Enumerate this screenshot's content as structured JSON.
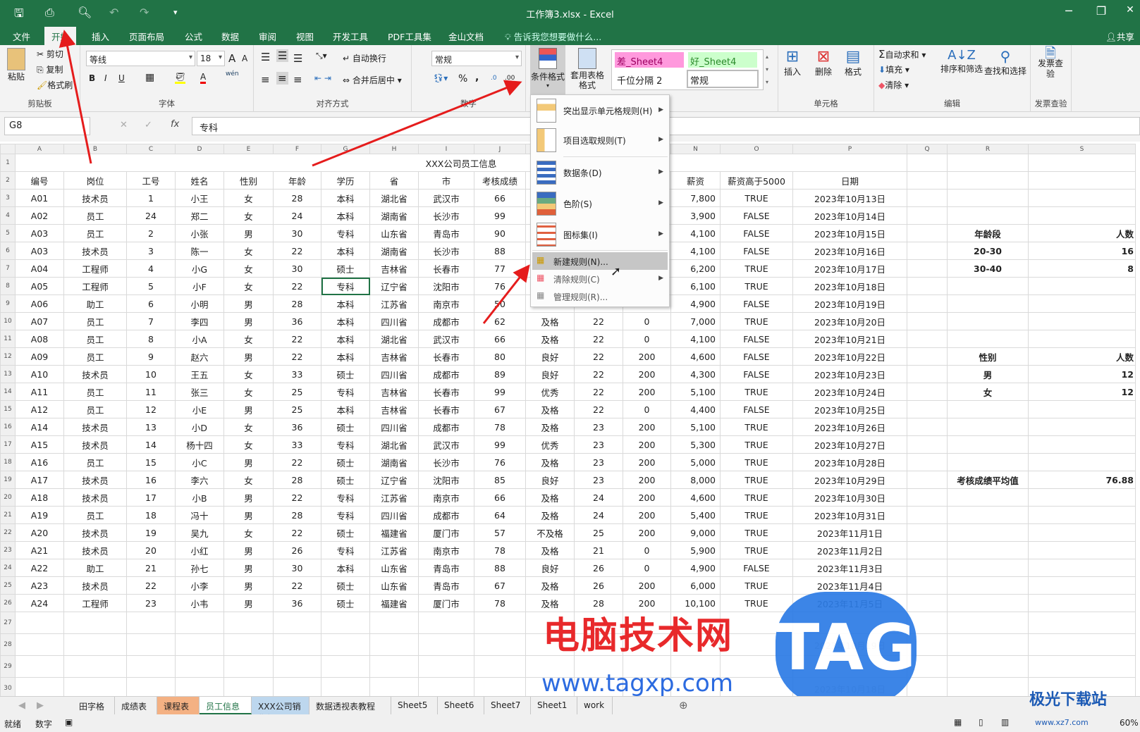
{
  "window": {
    "title": "工作簿3.xlsx - Excel",
    "minimize": "─",
    "restore": "❐",
    "close": "✕"
  },
  "ribbon_tabs": [
    "文件",
    "开始",
    "插入",
    "页面布局",
    "公式",
    "数据",
    "审阅",
    "视图",
    "开发工具",
    "PDF工具集",
    "金山文档"
  ],
  "tell_me": "告诉我您想要做什么...",
  "share": "共享",
  "clipboard": {
    "paste": "粘贴",
    "cut": "剪切",
    "copy": "复制",
    "format_painter": "格式刷",
    "label": "剪贴板"
  },
  "font": {
    "name": "等线",
    "size": "18",
    "bold": "B",
    "italic": "I",
    "underline": "U",
    "label": "字体",
    "grow": "A",
    "shrink": "A",
    "phonetic": "wén"
  },
  "alignment": {
    "wrap": "自动换行",
    "merge": "合并后居中",
    "label": "对齐方式"
  },
  "number": {
    "format": "常规",
    "percent": "%",
    "comma": ",",
    "label": "数字",
    "inc": ".00",
    "dec": ".0"
  },
  "styles": {
    "conditional": "条件格式",
    "table_format": "套用表格格式",
    "cell_styles": [
      "差_Sheet4",
      "好_Sheet4",
      "千位分隔 2",
      "常规"
    ],
    "bad_color": "#ff99dd",
    "good_color": "#ccffcc"
  },
  "cells": {
    "insert": "插入",
    "delete": "删除",
    "format": "格式",
    "label": "单元格"
  },
  "editing": {
    "autosum": "自动求和",
    "fill": "填充",
    "clear": "清除",
    "sort": "排序和筛选",
    "find": "查找和选择",
    "label": "编辑"
  },
  "invoice": {
    "button": "发票查验",
    "label": "发票查验"
  },
  "formula_bar": {
    "name_box": "G8",
    "fx": "fx",
    "value": "专科"
  },
  "columns": [
    "A",
    "B",
    "C",
    "D",
    "E",
    "F",
    "G",
    "H",
    "I",
    "J",
    "K",
    "L",
    "M",
    "N",
    "O",
    "P",
    "Q",
    "R",
    "S"
  ],
  "sheet": {
    "title": "XXX公司员工信息",
    "headers": [
      "编号",
      "岗位",
      "工号",
      "姓名",
      "性别",
      "年龄",
      "学历",
      "省",
      "市",
      "考核成绩",
      "",
      "",
      "",
      "薪资",
      "薪资高于5000",
      "日期"
    ],
    "rows": [
      [
        "A01",
        "技术员",
        "1",
        "小王",
        "女",
        "28",
        "本科",
        "湖北省",
        "武汉市",
        "66",
        "",
        "",
        "",
        "7,800",
        "TRUE",
        "2023年10月13日"
      ],
      [
        "A02",
        "员工",
        "24",
        "郑二",
        "女",
        "24",
        "本科",
        "湖南省",
        "长沙市",
        "99",
        "",
        "",
        "",
        "3,900",
        "FALSE",
        "2023年10月14日"
      ],
      [
        "A03",
        "员工",
        "2",
        "小张",
        "男",
        "30",
        "专科",
        "山东省",
        "青岛市",
        "90",
        "",
        "",
        "",
        "4,100",
        "FALSE",
        "2023年10月15日"
      ],
      [
        "A03",
        "技术员",
        "3",
        "陈一",
        "女",
        "22",
        "本科",
        "湖南省",
        "长沙市",
        "88",
        "",
        "",
        "",
        "4,100",
        "FALSE",
        "2023年10月16日"
      ],
      [
        "A04",
        "工程师",
        "4",
        "小G",
        "女",
        "30",
        "硕士",
        "吉林省",
        "长春市",
        "77",
        "",
        "",
        "",
        "6,200",
        "TRUE",
        "2023年10月17日"
      ],
      [
        "A05",
        "工程师",
        "5",
        "小F",
        "女",
        "22",
        "专科",
        "辽宁省",
        "沈阳市",
        "76",
        "",
        "",
        "",
        "6,100",
        "TRUE",
        "2023年10月18日"
      ],
      [
        "A06",
        "助工",
        "6",
        "小明",
        "男",
        "28",
        "本科",
        "江苏省",
        "南京市",
        "50",
        "",
        "",
        "",
        "4,900",
        "FALSE",
        "2023年10月19日"
      ],
      [
        "A07",
        "员工",
        "7",
        "李四",
        "男",
        "36",
        "本科",
        "四川省",
        "成都市",
        "62",
        "及格",
        "22",
        "0",
        "7,000",
        "TRUE",
        "2023年10月20日"
      ],
      [
        "A08",
        "员工",
        "8",
        "小A",
        "女",
        "22",
        "本科",
        "湖北省",
        "武汉市",
        "66",
        "及格",
        "22",
        "0",
        "4,100",
        "FALSE",
        "2023年10月21日"
      ],
      [
        "A09",
        "员工",
        "9",
        "赵六",
        "男",
        "22",
        "本科",
        "吉林省",
        "长春市",
        "80",
        "良好",
        "22",
        "200",
        "4,600",
        "FALSE",
        "2023年10月22日"
      ],
      [
        "A10",
        "技术员",
        "10",
        "王五",
        "女",
        "33",
        "硕士",
        "四川省",
        "成都市",
        "89",
        "良好",
        "22",
        "200",
        "4,300",
        "FALSE",
        "2023年10月23日"
      ],
      [
        "A11",
        "员工",
        "11",
        "张三",
        "女",
        "25",
        "专科",
        "吉林省",
        "长春市",
        "99",
        "优秀",
        "22",
        "200",
        "5,100",
        "TRUE",
        "2023年10月24日"
      ],
      [
        "A12",
        "员工",
        "12",
        "小E",
        "男",
        "25",
        "本科",
        "吉林省",
        "长春市",
        "67",
        "及格",
        "22",
        "0",
        "4,400",
        "FALSE",
        "2023年10月25日"
      ],
      [
        "A14",
        "技术员",
        "13",
        "小D",
        "女",
        "36",
        "硕士",
        "四川省",
        "成都市",
        "78",
        "及格",
        "23",
        "200",
        "5,100",
        "TRUE",
        "2023年10月26日"
      ],
      [
        "A15",
        "技术员",
        "14",
        "杨十四",
        "女",
        "33",
        "专科",
        "湖北省",
        "武汉市",
        "99",
        "优秀",
        "23",
        "200",
        "5,300",
        "TRUE",
        "2023年10月27日"
      ],
      [
        "A16",
        "员工",
        "15",
        "小C",
        "男",
        "22",
        "硕士",
        "湖南省",
        "长沙市",
        "76",
        "及格",
        "23",
        "200",
        "5,000",
        "TRUE",
        "2023年10月28日"
      ],
      [
        "A17",
        "技术员",
        "16",
        "李六",
        "女",
        "28",
        "硕士",
        "辽宁省",
        "沈阳市",
        "85",
        "良好",
        "23",
        "200",
        "8,000",
        "TRUE",
        "2023年10月29日"
      ],
      [
        "A18",
        "技术员",
        "17",
        "小B",
        "男",
        "22",
        "专科",
        "江苏省",
        "南京市",
        "66",
        "及格",
        "24",
        "200",
        "4,600",
        "TRUE",
        "2023年10月30日"
      ],
      [
        "A19",
        "员工",
        "18",
        "冯十",
        "男",
        "28",
        "专科",
        "四川省",
        "成都市",
        "64",
        "及格",
        "24",
        "200",
        "5,400",
        "TRUE",
        "2023年10月31日"
      ],
      [
        "A20",
        "技术员",
        "19",
        "吴九",
        "女",
        "22",
        "硕士",
        "福建省",
        "厦门市",
        "57",
        "不及格",
        "25",
        "200",
        "9,000",
        "TRUE",
        "2023年11月1日"
      ],
      [
        "A21",
        "技术员",
        "20",
        "小红",
        "男",
        "26",
        "专科",
        "江苏省",
        "南京市",
        "78",
        "及格",
        "21",
        "0",
        "5,900",
        "TRUE",
        "2023年11月2日"
      ],
      [
        "A22",
        "助工",
        "21",
        "孙七",
        "男",
        "30",
        "本科",
        "山东省",
        "青岛市",
        "88",
        "良好",
        "26",
        "0",
        "4,900",
        "FALSE",
        "2023年11月3日"
      ],
      [
        "A23",
        "技术员",
        "22",
        "小李",
        "男",
        "22",
        "硕士",
        "山东省",
        "青岛市",
        "67",
        "及格",
        "26",
        "200",
        "6,000",
        "TRUE",
        "2023年11月4日"
      ],
      [
        "A24",
        "工程师",
        "23",
        "小韦",
        "男",
        "36",
        "硕士",
        "福建省",
        "厦门市",
        "78",
        "及格",
        "28",
        "200",
        "10,100",
        "TRUE",
        "2023年11月5日"
      ]
    ],
    "side": {
      "5": [
        "年龄段",
        "人数"
      ],
      "6": [
        "20-30",
        "16"
      ],
      "7": [
        "30-40",
        "8"
      ],
      "12": [
        "性别",
        "人数"
      ],
      "13": [
        "男",
        "12"
      ],
      "14": [
        "女",
        "12"
      ],
      "19": [
        "考核成绩平均值",
        "76.88"
      ]
    },
    "extra_rows": {
      "28": "2023年10月19日",
      "30": "2023年10月18日"
    }
  },
  "menu": {
    "items": [
      {
        "label": "突出显示单元格规则(H)",
        "sub": true
      },
      {
        "label": "项目选取规则(T)",
        "sub": true
      },
      {
        "label": "数据条(D)",
        "sub": true
      },
      {
        "label": "色阶(S)",
        "sub": true
      },
      {
        "label": "图标集(I)",
        "sub": true
      },
      {
        "label": "新建规则(N)...",
        "sub": false
      },
      {
        "label": "清除规则(C)",
        "sub": true
      },
      {
        "label": "管理规则(R)...",
        "sub": false
      }
    ]
  },
  "sheet_tabs": [
    {
      "label": "田字格"
    },
    {
      "label": "成绩表"
    },
    {
      "label": "课程表",
      "color": "#f4b183"
    },
    {
      "label": "员工信息",
      "active": true
    },
    {
      "label": "XXX公司销售额",
      "color": "#bdd7ee"
    },
    {
      "label": "数据透视表教程"
    },
    {
      "label": "Sheet5"
    },
    {
      "label": "Sheet6"
    },
    {
      "label": "Sheet7"
    },
    {
      "label": "Sheet1"
    },
    {
      "label": "work"
    }
  ],
  "status": {
    "ready": "就绪",
    "mode": "数字",
    "zoom": "60%"
  },
  "watermark": {
    "text1": "电脑技术网",
    "logo": "TAG",
    "url": "www.tagxp.com",
    "site": "极光下载站",
    "site_url": "www.xz7.com"
  }
}
